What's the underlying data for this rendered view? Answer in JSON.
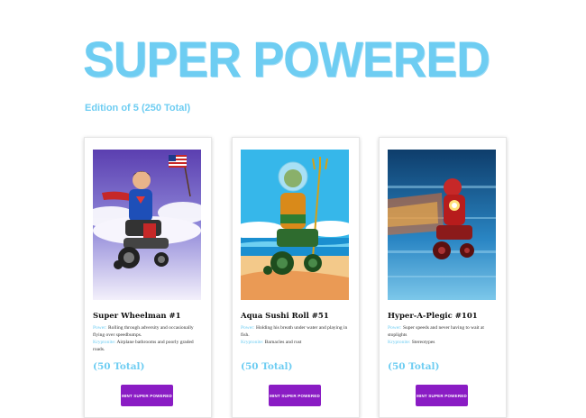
{
  "header": {
    "title": "SUPER POWERED",
    "subtitle": "Edition of 5 (250 Total)"
  },
  "colors": {
    "accent": "#6ecdf2",
    "button": "#8a1cc4"
  },
  "cards": [
    {
      "name": "Super Wheelman #1",
      "power_label": "Power:",
      "power_text": "Rolling through adversity and occasionally flying over speedbumps.",
      "kryptonite_label": "Kryptonite:",
      "kryptonite_text": "Airplane bathrooms and poorly graded roads.",
      "total": "(50 Total)",
      "button_label": "MINT SUPER POWERED"
    },
    {
      "name": "Aqua Sushi Roll #51",
      "power_label": "Power:",
      "power_text": "Holding his breath under water and playing in fish.",
      "kryptonite_label": "Kryptonite:",
      "kryptonite_text": "Barnacles and rust",
      "total": "(50 Total)",
      "button_label": "MINT SUPER POWERED"
    },
    {
      "name": "Hyper-A-Plegic #101",
      "power_label": "Power:",
      "power_text": "Super speeds and never having to wait at stoplights",
      "kryptonite_label": "Kryptonite:",
      "kryptonite_text": "Stereotypes",
      "total": "(50 Total)",
      "button_label": "MINT SUPER POWERED"
    }
  ]
}
